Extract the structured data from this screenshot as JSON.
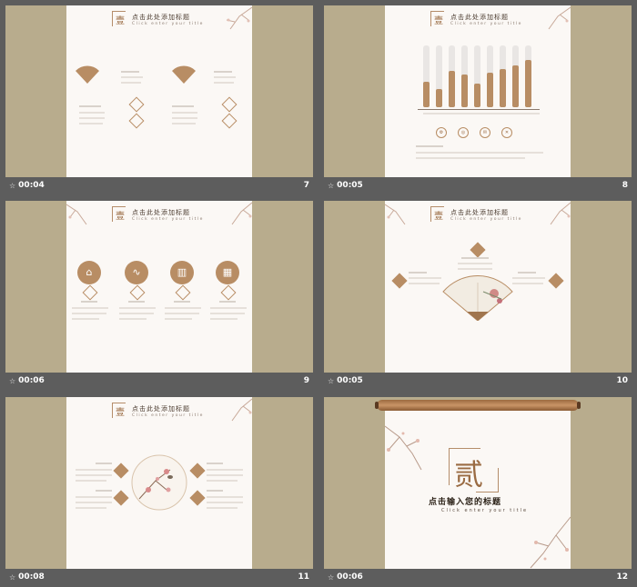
{
  "slides": [
    {
      "time": "00:04",
      "num": "7"
    },
    {
      "time": "00:05",
      "num": "8"
    },
    {
      "time": "00:06",
      "num": "9"
    },
    {
      "time": "00:05",
      "num": "10"
    },
    {
      "time": "00:08",
      "num": "11"
    },
    {
      "time": "00:06",
      "num": "12"
    }
  ],
  "header": {
    "seal_char": "壹",
    "title": "点击此处添加标题",
    "subtitle": "Click enter your title"
  },
  "section": {
    "char": "贰",
    "title": "点击输入您的标题",
    "subtitle": "Click enter your title"
  },
  "colors": {
    "brand": "#b88d64",
    "bg_frame": "#b8ac8d",
    "page_bg": "#fbf8f5",
    "window_bg": "#5d5d5d"
  },
  "icons": {
    "transition": "star-icon",
    "slide8_rings": [
      "gear-icon",
      "target-icon",
      "chat-icon",
      "x-icon"
    ],
    "slide9_circles": [
      "building-icon",
      "trend-icon",
      "bar-chart-icon",
      "blocks-icon"
    ]
  }
}
